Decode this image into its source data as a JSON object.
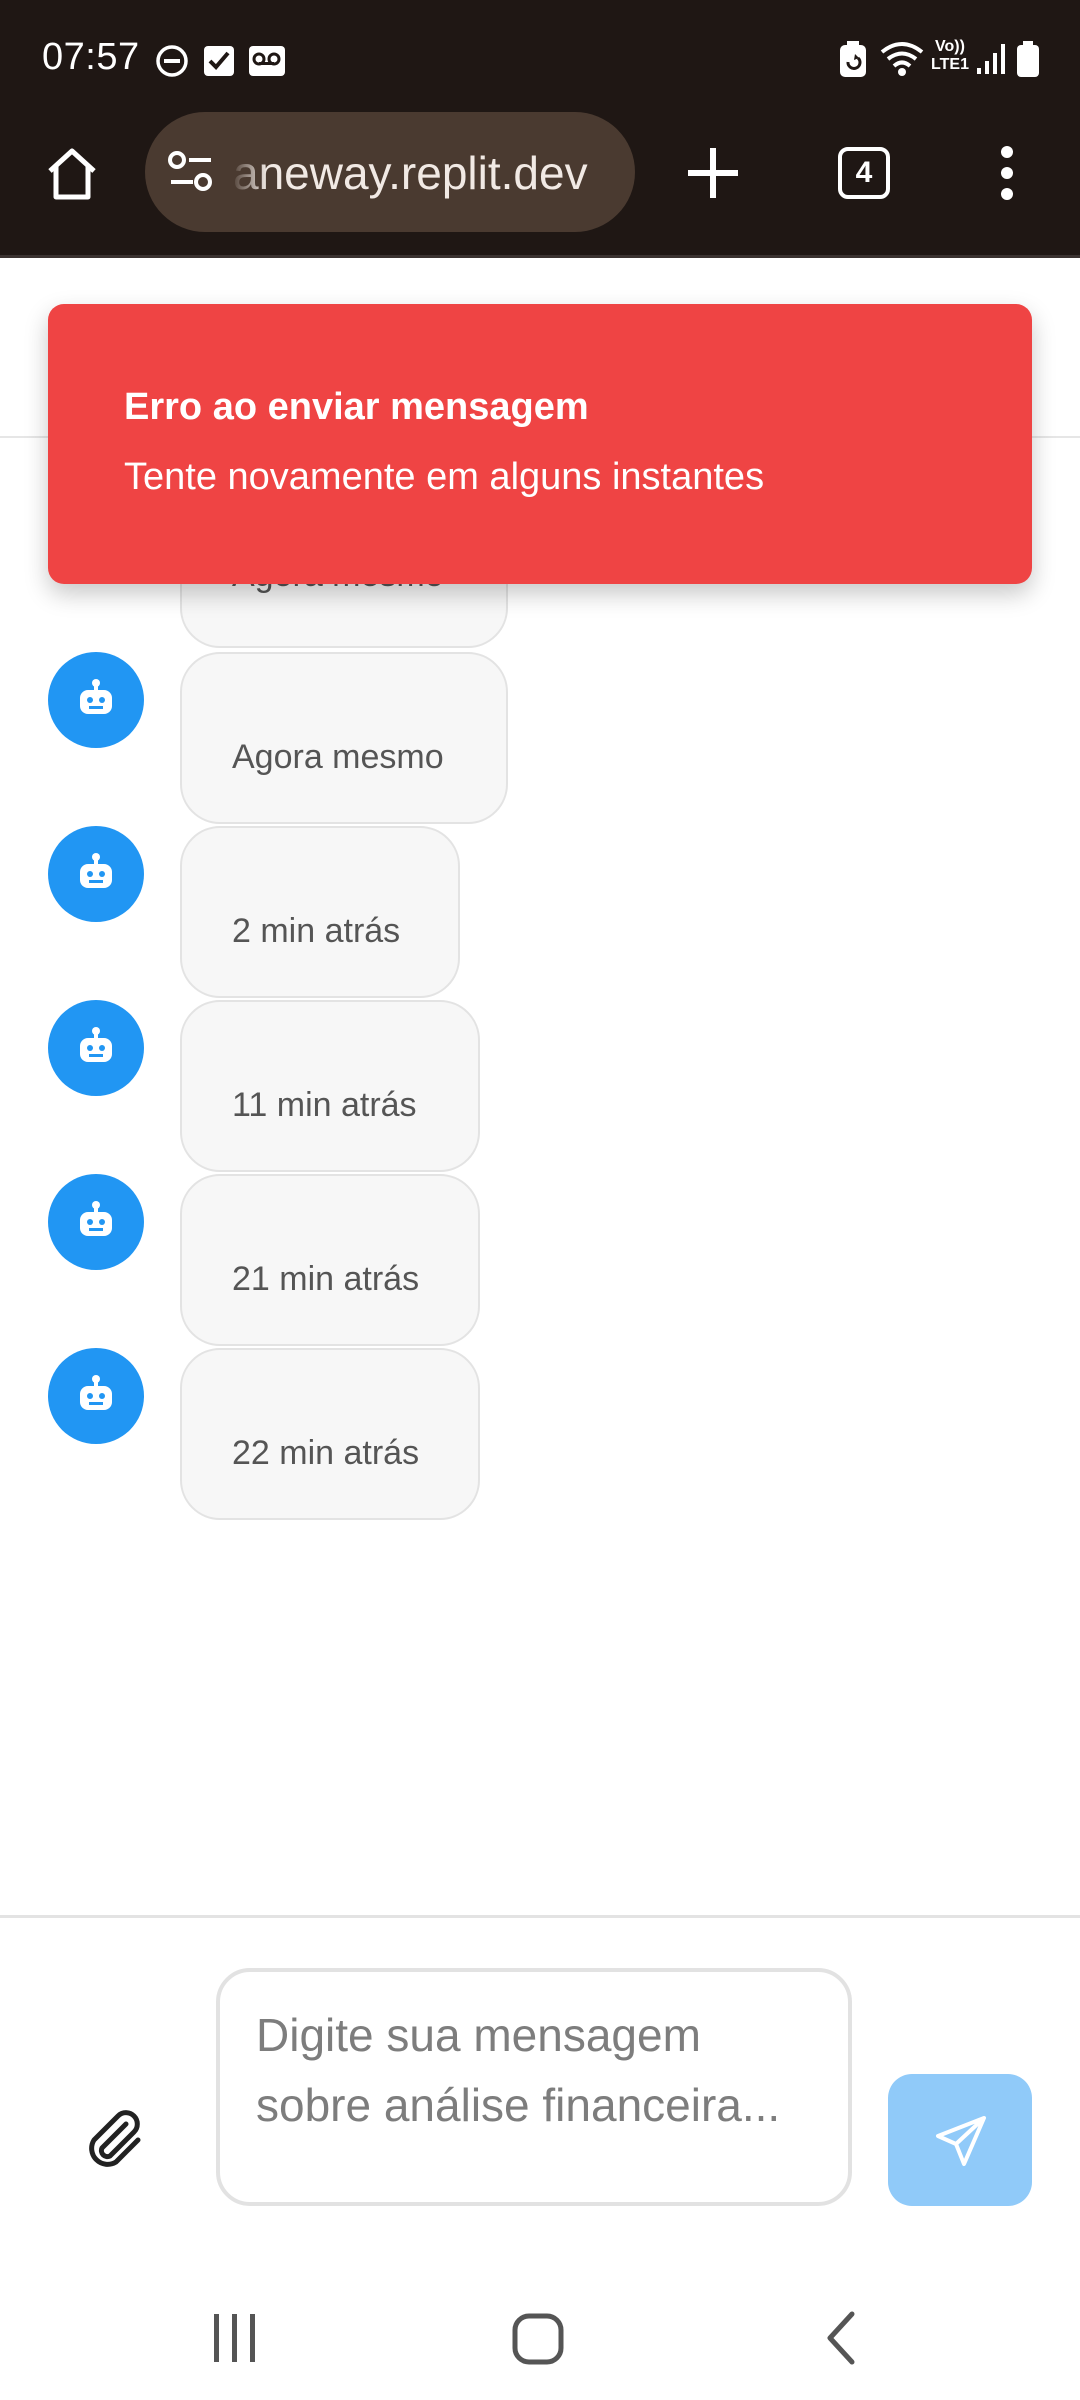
{
  "status_bar": {
    "time": "07:57",
    "icons": [
      "do-not-disturb-icon",
      "checkbox-notification-icon",
      "voicemail-icon",
      "battery-saver-icon",
      "wifi-icon",
      "volte-icon",
      "signal-icon",
      "battery-icon"
    ],
    "network_label_top": "Vo))",
    "network_label_bottom": "LTE1"
  },
  "browser": {
    "url": "aneway.replit.dev",
    "tab_count": "4",
    "icons": [
      "home-icon",
      "site-settings-icon",
      "new-tab-icon",
      "tabs-icon",
      "menu-icon"
    ]
  },
  "toast": {
    "title": "Erro ao enviar mensagem",
    "description": "Tente novamente em alguns instantes",
    "color": "#ef4444"
  },
  "messages": [
    {
      "time": "Agora mesmo"
    },
    {
      "time": "Agora mesmo"
    },
    {
      "time": "2 min atrás"
    },
    {
      "time": "11 min atrás"
    },
    {
      "time": "21 min atrás"
    },
    {
      "time": "22 min atrás"
    }
  ],
  "composer": {
    "placeholder": "Digite sua mensagem sobre análise financeira...",
    "value": ""
  },
  "colors": {
    "accent": "#2196f3",
    "send_button": "#90caf9",
    "browser_bar": "#1f1714"
  },
  "nav_icons": [
    "recents-icon",
    "home-nav-icon",
    "back-icon"
  ]
}
